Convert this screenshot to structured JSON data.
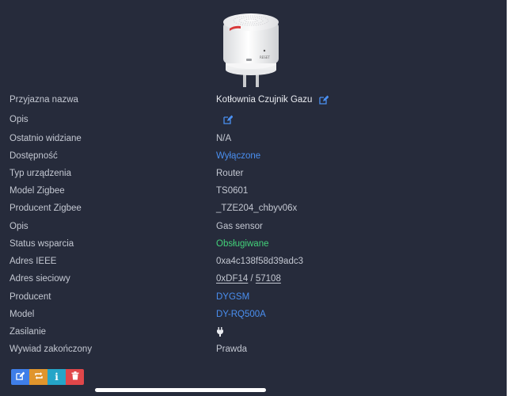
{
  "device_image": {
    "reset_text": "RESET"
  },
  "details": [
    {
      "label": "Przyjazna nazwa",
      "value": "Kotłownia Czujnik Gazu",
      "style": "white",
      "editable": true
    },
    {
      "label": "Opis",
      "value": "",
      "style": "normal",
      "editable": true
    },
    {
      "label": "Ostatnio widziane",
      "value": "N/A",
      "style": "normal"
    },
    {
      "label": "Dostępność",
      "value": "Wyłączone",
      "style": "blue"
    },
    {
      "label": "Typ urządzenia",
      "value": "Router",
      "style": "normal"
    },
    {
      "label": "Model Zigbee",
      "value": "TS0601",
      "style": "normal"
    },
    {
      "label": "Producent Zigbee",
      "value": "_TZE204_chbyv06x",
      "style": "normal"
    },
    {
      "label": "Opis",
      "value": "Gas sensor",
      "style": "normal"
    },
    {
      "label": "Status wsparcia",
      "value": "Obsługiwane",
      "style": "green"
    },
    {
      "label": "Adres IEEE",
      "value": "0xa4c138f58d39adc3",
      "style": "normal"
    },
    {
      "label": "Adres sieciowy",
      "value_hex": "0xDF14",
      "separator": " / ",
      "value_dec": "57108",
      "style": "normal"
    },
    {
      "label": "Producent",
      "value": "DYGSM",
      "style": "blue"
    },
    {
      "label": "Model",
      "value": "DY-RQ500A",
      "style": "blue"
    },
    {
      "label": "Zasilanie",
      "value": "",
      "icon": "plug-icon",
      "style": "normal"
    },
    {
      "label": "Wywiad zakończony",
      "value": "Prawda",
      "style": "normal"
    }
  ],
  "toolbar": {
    "buttons": [
      {
        "name": "rename-button",
        "icon": "edit-icon",
        "color": "#3f7ee8"
      },
      {
        "name": "reconfigure-button",
        "icon": "refresh-icon",
        "color": "#e0952d"
      },
      {
        "name": "interview-button",
        "icon": "info-icon",
        "color": "#25a5c8"
      },
      {
        "name": "remove-button",
        "icon": "trash-icon",
        "color": "#e0474a"
      }
    ]
  },
  "colors": {
    "background": "#262b3b",
    "text": "#c4c8d2",
    "link": "#4a8ff0",
    "success": "#43d17a"
  }
}
